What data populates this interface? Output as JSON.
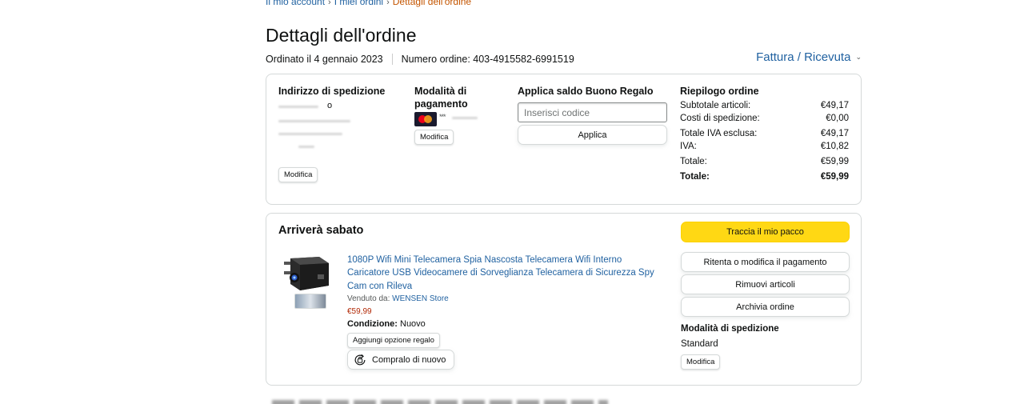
{
  "breadcrumb": {
    "items": [
      "Il mio account",
      "I miei ordini"
    ],
    "current": "Dettagli dell'ordine",
    "separator": "›"
  },
  "page_title": "Dettagli dell'ordine",
  "order_meta": {
    "date": "Ordinato il 4 gennaio 2023",
    "number": "Numero ordine: 403-4915582-6991519"
  },
  "invoice_label": "Fattura / Ricevuta",
  "shipping_address": {
    "title": "Indirizzo di spedizione",
    "partial_text": "o",
    "edit_label": "Modifica"
  },
  "payment": {
    "title": "Modalità di pagamento",
    "card_digits": "***",
    "edit_label": "Modifica"
  },
  "gift_card": {
    "title": "Applica saldo Buono Regalo",
    "placeholder": "Inserisci codice",
    "apply_label": "Applica"
  },
  "order_summary": {
    "title": "Riepilogo ordine",
    "rows": [
      {
        "label": "Subtotale articoli:",
        "value": "€49,17"
      },
      {
        "label": "Costi di spedizione:",
        "value": "€0,00"
      },
      {
        "label": "Totale IVA esclusa:",
        "value": "€49,17"
      },
      {
        "label": "IVA:",
        "value": "€10,82"
      },
      {
        "label": "Totale:",
        "value": "€59,99"
      }
    ],
    "grand_total": {
      "label": "Totale:",
      "value": "€59,99"
    }
  },
  "shipment": {
    "arrival": "Arriverà sabato",
    "product": {
      "title": "1080P Wifi Mini Telecamera Spia Nascosta Telecamera Wifi Interno Caricatore USB Videocamere di Sorveglianza Telecamera di Sicurezza Spy Cam con Rileva",
      "seller_prefix": "Venduto da:",
      "seller_name": "WENSEN Store",
      "price": "€59,99",
      "condition_label": "Condizione:",
      "condition_value": "Nuovo",
      "gift_option_label": "Aggiungi opzione regalo",
      "buy_again_label": "Compralo di nuovo"
    },
    "actions": {
      "track": "Traccia il mio pacco",
      "retry_payment": "Ritenta o modifica il pagamento",
      "remove_items": "Rimuovi articoli",
      "archive": "Archivia ordine"
    },
    "shipping_method": {
      "title": "Modalità di spedizione",
      "value": "Standard",
      "edit_label": "Modifica"
    }
  },
  "colors": {
    "link": "#2162a1",
    "accent_orange": "#c45500",
    "price_red": "#b12704",
    "primary_button": "#ffd814"
  },
  "icons": {
    "invoice_dropdown": "chevron-down-icon",
    "buy_again": "buy-again-icon",
    "card": "mastercard-icon"
  }
}
